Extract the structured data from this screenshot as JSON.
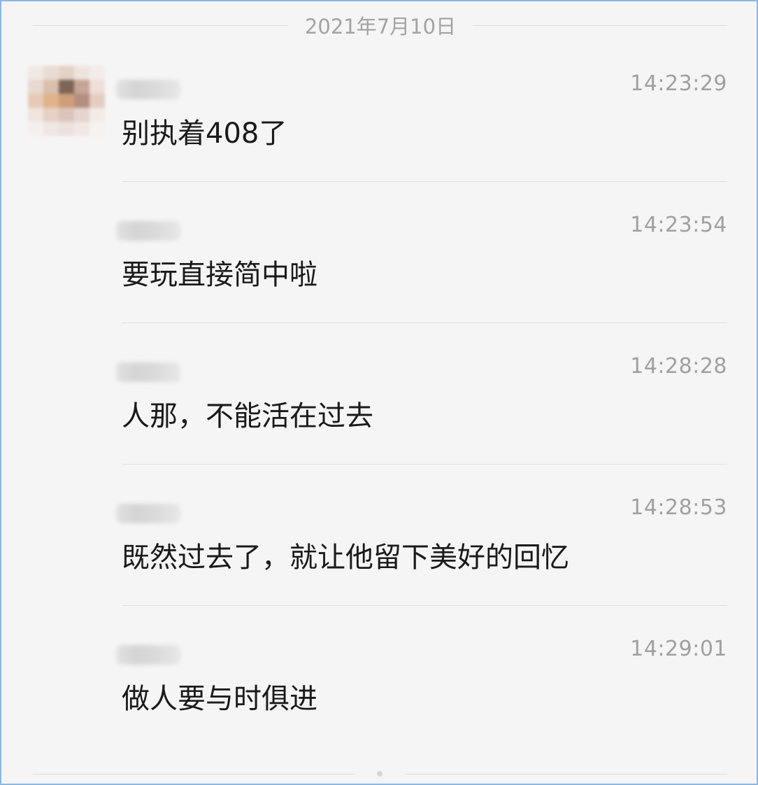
{
  "date_separator": "2021年7月10日",
  "messages": [
    {
      "time": "14:23:29",
      "text": "别执着408了"
    },
    {
      "time": "14:23:54",
      "text": "要玩直接简中啦"
    },
    {
      "time": "14:28:28",
      "text": "人那，不能活在过去"
    },
    {
      "time": "14:28:53",
      "text": "既然过去了，就让他留下美好的回忆"
    },
    {
      "time": "14:29:01",
      "text": "做人要与时俱进"
    }
  ],
  "colors": {
    "background": "#f5f5f5",
    "border": "#8cb8e2",
    "message_text": "#1a1a1a",
    "meta_text": "#a3a3a3"
  },
  "icons": {
    "avatar": "pixelated-avatar-icon",
    "pager": "pager-dot-icon"
  }
}
